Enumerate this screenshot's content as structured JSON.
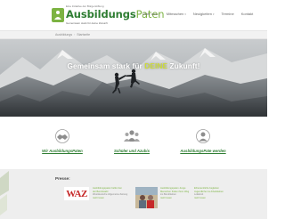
{
  "header": {
    "logo_tagline": "Eine Initiative der Bürgerstiftung",
    "logo_main": "Ausbildungs",
    "logo_accent": "Paten",
    "logo_sub": "Gemeinsam stark für deine Zukunft",
    "nav": [
      {
        "label": "Über uns",
        "has_dropdown": true
      },
      {
        "label": "Mitmachen",
        "has_dropdown": true
      },
      {
        "label": "Neuigkeiten",
        "has_dropdown": true
      },
      {
        "label": "Termine",
        "has_dropdown": false
      },
      {
        "label": "Kontakt",
        "has_dropdown": false
      }
    ]
  },
  "breadcrumb": {
    "home": "Ausbildungs",
    "separator": "›",
    "current": "Startseite"
  },
  "hero": {
    "title_before": "Gemeinsam stark für ",
    "title_highlight": "DEINE",
    "title_after": " Zukunft!"
  },
  "features": [
    {
      "label": "Wir AusbildungsPaten",
      "icon": "handshake-icon"
    },
    {
      "label": "Schüler und Azubis",
      "icon": "group-icon"
    },
    {
      "label": "AusbildungsPate werden",
      "icon": "person-icon"
    }
  ],
  "partners": {
    "title": "Presse:",
    "items": [
      {
        "logo_text": "WAZ",
        "lines": [
          "Ausbildungspaten helfen bei",
          "der Berufswahl",
          "Westdeutsche Allgemeine Zeitung",
          "mehr lesen"
        ]
      },
      {
        "lines": [
          "Ausbildungspaten Junge",
          "Menschen finden ihren Weg",
          "ins Berufsleben",
          "mehr lesen"
        ]
      },
      {
        "lines": [
          "Ehrenamtliche begleiten",
          "Jugendliche ins Arbeitsleben",
          "Lokalzeit",
          "mehr lesen"
        ]
      }
    ]
  },
  "colors": {
    "brand_green": "#2e7d32",
    "accent_green": "#7cb342",
    "highlight_yellow": "#cddc39",
    "waz_red": "#c62828"
  }
}
